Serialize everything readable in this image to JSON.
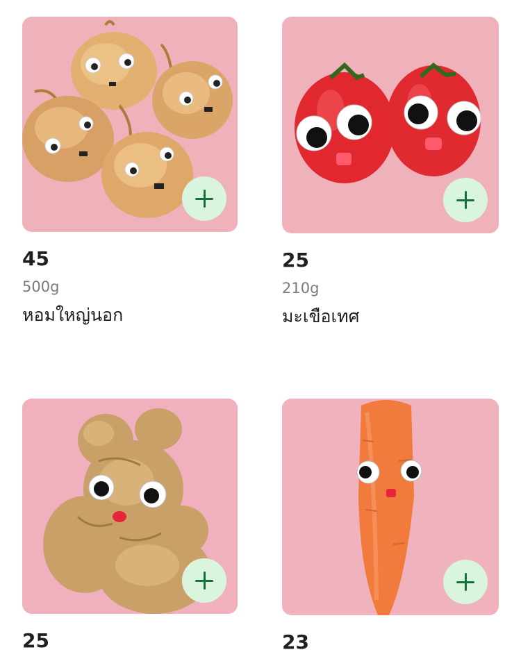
{
  "products": [
    {
      "price": "45",
      "weight": "500g",
      "name": "หอมใหญ่นอก",
      "image_icon": "onions-with-googly-eyes"
    },
    {
      "price": "25",
      "weight": "210g",
      "name": "มะเขือเทศ",
      "image_icon": "tomatoes-with-googly-eyes"
    },
    {
      "price": "25",
      "weight": "",
      "name": "",
      "image_icon": "ginger-with-googly-eyes"
    },
    {
      "price": "23",
      "weight": "",
      "name": "",
      "image_icon": "carrot-with-googly-eyes"
    }
  ],
  "colors": {
    "photo_background": "#f0b3bd",
    "add_button_bg": "#d9f5de",
    "add_button_icon": "#17703a",
    "price_text": "#1f1f1f",
    "weight_text": "#7a7a7a"
  }
}
